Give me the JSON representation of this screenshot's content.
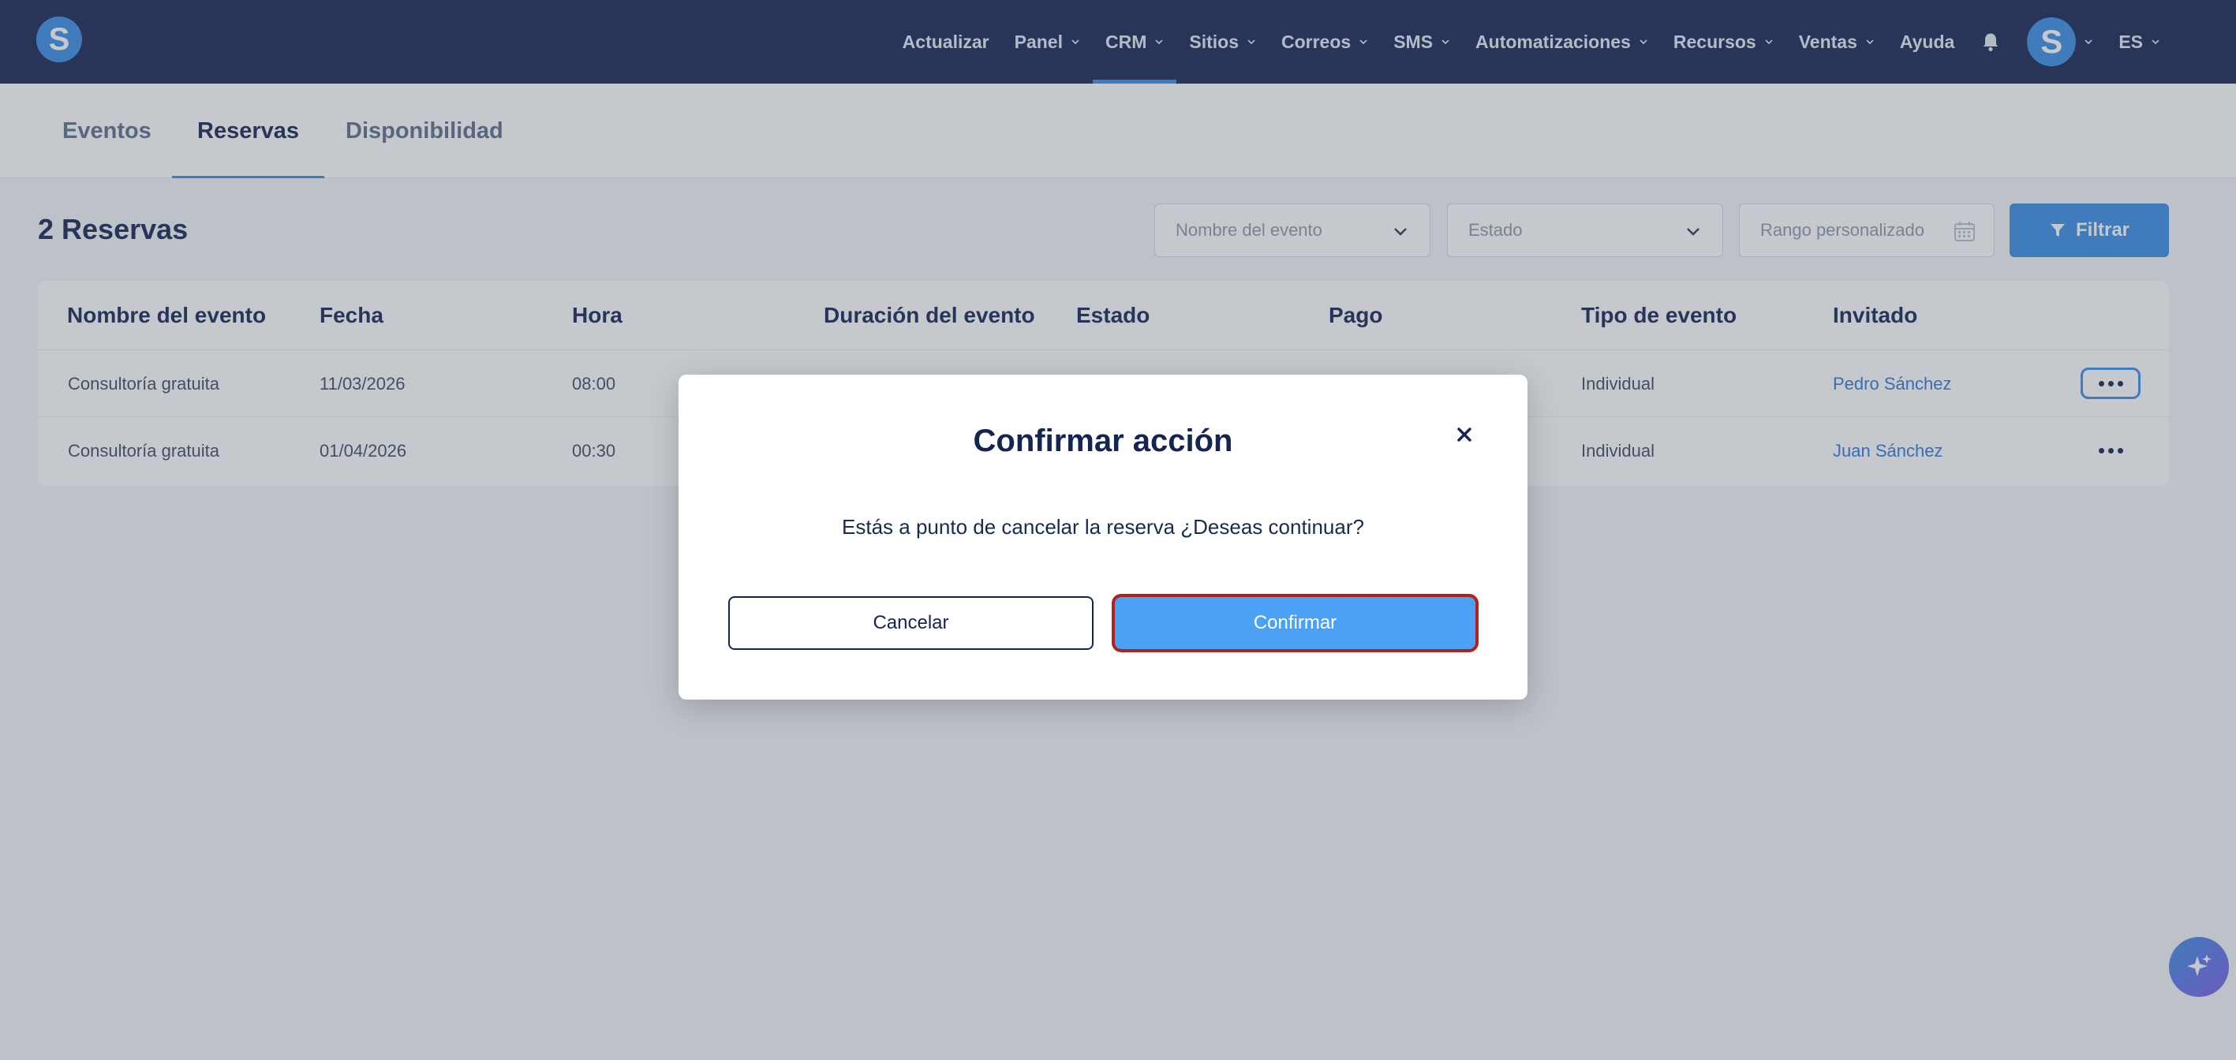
{
  "nav": {
    "logo_letter": "S",
    "items": [
      {
        "label": "Actualizar",
        "has_dropdown": false
      },
      {
        "label": "Panel",
        "has_dropdown": true
      },
      {
        "label": "CRM",
        "has_dropdown": true,
        "active": true
      },
      {
        "label": "Sitios",
        "has_dropdown": true
      },
      {
        "label": "Correos",
        "has_dropdown": true
      },
      {
        "label": "SMS",
        "has_dropdown": true
      },
      {
        "label": "Automatizaciones",
        "has_dropdown": true
      },
      {
        "label": "Recursos",
        "has_dropdown": true
      },
      {
        "label": "Ventas",
        "has_dropdown": true
      },
      {
        "label": "Ayuda",
        "has_dropdown": false
      }
    ],
    "bell_icon": "bell-icon",
    "avatar_letter": "S",
    "language": "ES"
  },
  "subtabs": [
    {
      "label": "Eventos"
    },
    {
      "label": "Reservas",
      "active": true
    },
    {
      "label": "Disponibilidad"
    }
  ],
  "main": {
    "count_title": "2 Reservas",
    "filters": {
      "event_name_placeholder": "Nombre del evento",
      "status_placeholder": "Estado",
      "date_range_placeholder": "Rango personalizado",
      "filter_label": "Filtrar"
    },
    "table": {
      "columns": [
        "Nombre del evento",
        "Fecha",
        "Hora",
        "Duración del evento",
        "Estado",
        "Pago",
        "Tipo de evento",
        "Invitado"
      ],
      "rows": [
        {
          "event": "Consultoría gratuita",
          "date": "11/03/2026",
          "time": "08:00",
          "type": "Individual",
          "guest": "Pedro Sánchez"
        },
        {
          "event": "Consultoría gratuita",
          "date": "01/04/2026",
          "time": "00:30",
          "type": "Individual",
          "guest": "Juan Sánchez"
        }
      ]
    }
  },
  "modal": {
    "title": "Confirmar acción",
    "message": "Estás a punto de cancelar la reserva ¿Deseas continuar?",
    "cancel_label": "Cancelar",
    "confirm_label": "Confirmar"
  },
  "colors": {
    "nav_bg": "#152551",
    "accent": "#3a8ee6",
    "confirm_bg": "#4aa1f6",
    "confirm_border": "#b3211f"
  }
}
